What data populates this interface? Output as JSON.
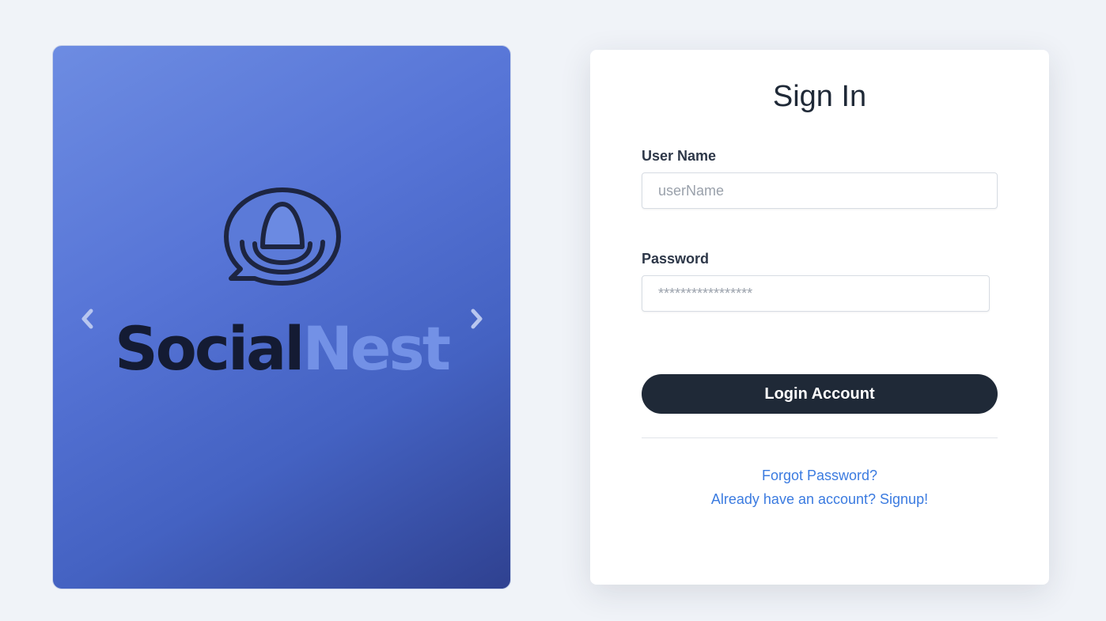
{
  "carousel": {
    "brand_part1": "Social",
    "brand_part2": "Nest",
    "logo_icon": "chat-bubble-nest-logo",
    "prev_icon": "chevron-left-icon",
    "next_icon": "chevron-right-icon"
  },
  "signin": {
    "title": "Sign In",
    "username_label": "User Name",
    "username_placeholder": "userName",
    "password_label": "Password",
    "password_placeholder": "*****************",
    "login_button": "Login Account",
    "forgot_link": "Forgot Password?",
    "signup_link": "Already have an account? Signup!"
  },
  "colors": {
    "page_background": "#f0f3f8",
    "carousel_gradient_start": "#6d8ce2",
    "carousel_gradient_end": "#2f4190",
    "brand_dark": "#141b33",
    "brand_light": "#7391e6",
    "button_background": "#1f2937",
    "link": "#3b7be0"
  }
}
